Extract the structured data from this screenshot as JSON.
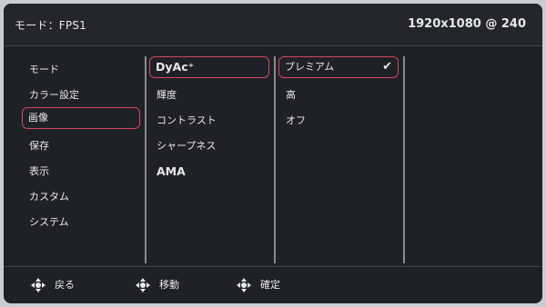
{
  "header": {
    "mode_text": "モード：FPS1",
    "resolution_text": "1920x1080 @ 240"
  },
  "menu_main": {
    "items": [
      {
        "label": "モード"
      },
      {
        "label": "カラー設定"
      },
      {
        "label": "画像",
        "selected": true
      },
      {
        "label": "保存"
      },
      {
        "label": "表示"
      },
      {
        "label": "カスタム"
      },
      {
        "label": "システム"
      }
    ]
  },
  "menu_sub": {
    "items": [
      {
        "label": "DyAc⁺",
        "selected": true
      },
      {
        "label": "輝度"
      },
      {
        "label": "コントラスト"
      },
      {
        "label": "シャープネス"
      },
      {
        "label": "AMA"
      }
    ]
  },
  "menu_options": {
    "items": [
      {
        "label": "プレミアム",
        "selected": true,
        "checked": true,
        "check_icon": "checkmark-icon"
      },
      {
        "label": "高"
      },
      {
        "label": "オフ"
      }
    ]
  },
  "footer": {
    "back_label": "戻る",
    "move_label": "移動",
    "confirm_label": "確定",
    "icons": {
      "back": "joystick-left-icon",
      "move": "joystick-updown-icon",
      "confirm": "joystick-press-icon"
    }
  },
  "colors": {
    "selection_border": "#d64657",
    "background": "#1f2128",
    "text": "#e8e8ea"
  }
}
